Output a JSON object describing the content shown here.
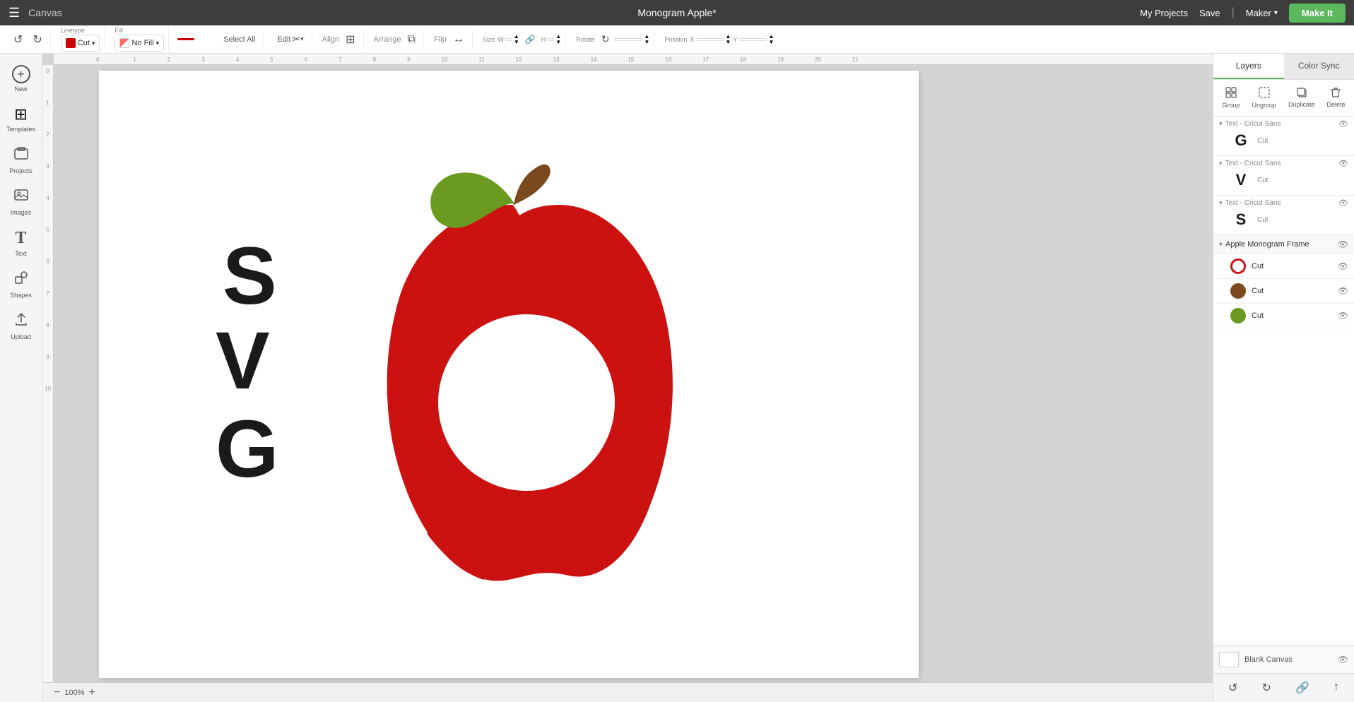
{
  "app": {
    "title": "Canvas",
    "project_title": "Monogram Apple*"
  },
  "top_nav": {
    "canvas_label": "Canvas",
    "project_title": "Monogram Apple*",
    "my_projects": "My Projects",
    "save": "Save",
    "maker_label": "Maker",
    "make_it": "Make It"
  },
  "toolbar": {
    "undo_label": "↺",
    "redo_label": "↻",
    "linetype_label": "Linetype",
    "linetype_value": "Cut",
    "fill_label": "Fill",
    "fill_value": "No Fill",
    "select_all": "Select All",
    "edit_label": "Edit",
    "align_label": "Align",
    "arrange_label": "Arrange",
    "flip_label": "Flip",
    "size_label": "Size",
    "rotate_label": "Rotate",
    "position_label": "Position",
    "w_label": "W",
    "h_label": "H"
  },
  "left_sidebar": {
    "items": [
      {
        "id": "new",
        "label": "New",
        "icon": "+"
      },
      {
        "id": "templates",
        "label": "Templates",
        "icon": "⊞"
      },
      {
        "id": "projects",
        "label": "Projects",
        "icon": "⊡"
      },
      {
        "id": "images",
        "label": "Images",
        "icon": "🖼"
      },
      {
        "id": "text",
        "label": "Text",
        "icon": "T"
      },
      {
        "id": "shapes",
        "label": "Shapes",
        "icon": "◇"
      },
      {
        "id": "upload",
        "label": "Upload",
        "icon": "↑"
      }
    ]
  },
  "right_panel": {
    "tabs": [
      {
        "id": "layers",
        "label": "Layers",
        "active": true
      },
      {
        "id": "color_sync",
        "label": "Color Sync",
        "active": false
      }
    ],
    "actions": [
      {
        "id": "group",
        "label": "Group",
        "icon": "⊞",
        "disabled": false
      },
      {
        "id": "ungroup",
        "label": "Ungroup",
        "icon": "⊟",
        "disabled": false
      },
      {
        "id": "duplicate",
        "label": "Duplicate",
        "icon": "⧉",
        "disabled": false
      },
      {
        "id": "delete",
        "label": "Delete",
        "icon": "🗑",
        "disabled": false
      }
    ],
    "text_layers": [
      {
        "id": "text_g",
        "name": "Text - Cricut Sans",
        "char": "G",
        "cut": "Cut"
      },
      {
        "id": "text_v",
        "name": "Text - Cricut Sans",
        "char": "V",
        "cut": "Cut"
      },
      {
        "id": "text_s",
        "name": "Text - Cricut Sans",
        "char": "S",
        "cut": "Cut"
      }
    ],
    "apple_group": {
      "name": "Apple Monogram Frame",
      "items": [
        {
          "id": "apple_body",
          "color": "red",
          "cut": "Cut",
          "swatch_type": "red"
        },
        {
          "id": "apple_stem",
          "color": "#7a4a1e",
          "cut": "Cut",
          "swatch_type": "brown"
        },
        {
          "id": "apple_leaf",
          "color": "#5a8a1e",
          "cut": "Cut",
          "swatch_type": "green"
        }
      ]
    },
    "blank_canvas": {
      "label": "Blank Canvas"
    }
  },
  "canvas": {
    "zoom": "100%",
    "zoom_minus": "−",
    "zoom_plus": "+"
  }
}
